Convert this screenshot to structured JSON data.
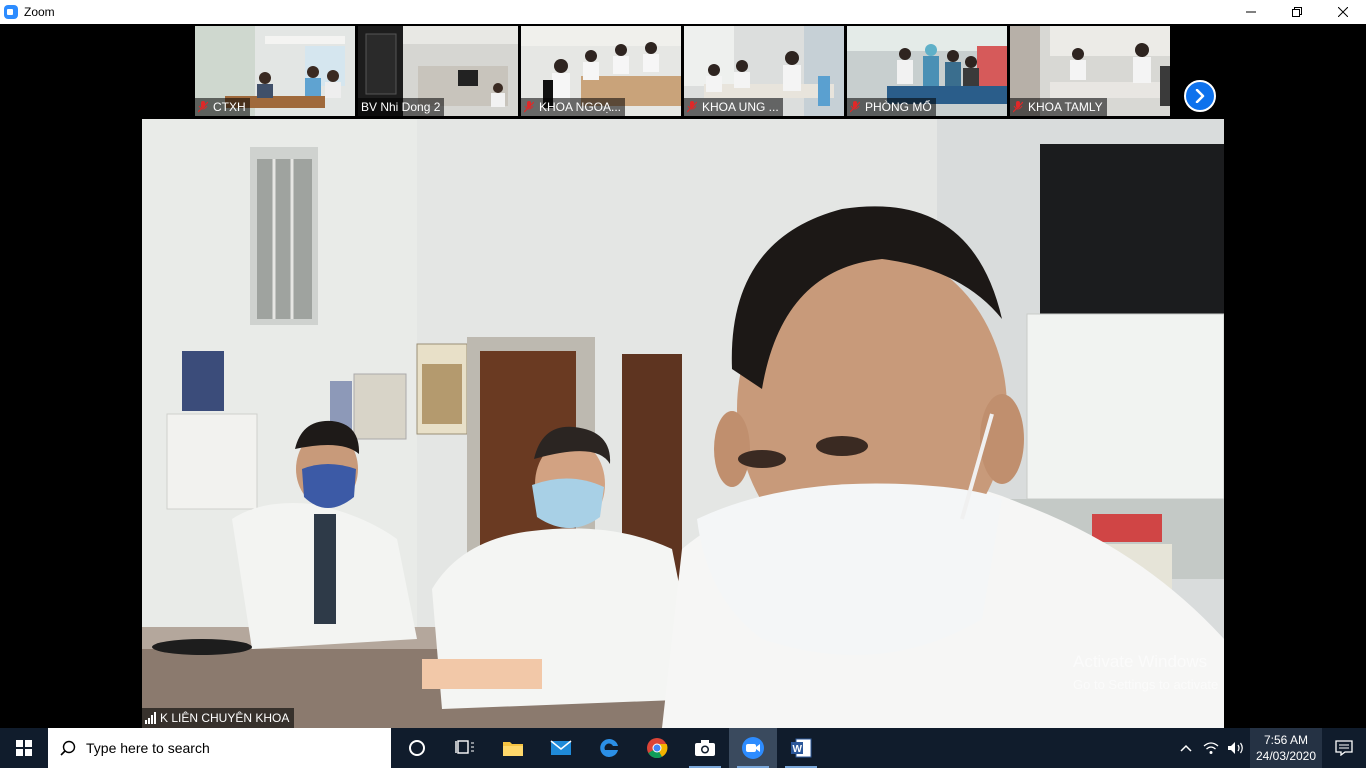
{
  "window": {
    "title": "Zoom",
    "controls": [
      "minimize-icon",
      "restore-icon",
      "close-icon"
    ]
  },
  "gallery": {
    "participants": [
      {
        "name": "CTXH",
        "muted": true
      },
      {
        "name": "BV Nhi Dong 2",
        "muted": false
      },
      {
        "name": "KHOA NGOẠ...",
        "muted": true
      },
      {
        "name": "KHOA UNG ...",
        "muted": true
      },
      {
        "name": "PHÒNG MỔ",
        "muted": true
      },
      {
        "name": "KHOA TAMLY",
        "muted": true
      }
    ],
    "next_icon": "chevron-right-icon"
  },
  "main_video": {
    "speaker_name": "K LIÊN CHUYÊN KHOA",
    "watermark_line1": "Activate Windows",
    "watermark_line2": "Go to Settings to activate"
  },
  "taskbar": {
    "search_placeholder": "Type here to search",
    "apps": [
      "cortana-icon",
      "task-view-icon",
      "file-explorer-icon",
      "mail-icon",
      "edge-icon",
      "chrome-icon",
      "camera-icon",
      "zoom-icon",
      "word-icon"
    ],
    "active_app": "zoom-icon",
    "clock_time": "7:56 AM",
    "clock_date": "24/03/2020"
  },
  "colors": {
    "zoom_blue": "#0e72ed",
    "taskbar": "#101c2c",
    "mic_muted": "#e02828"
  }
}
